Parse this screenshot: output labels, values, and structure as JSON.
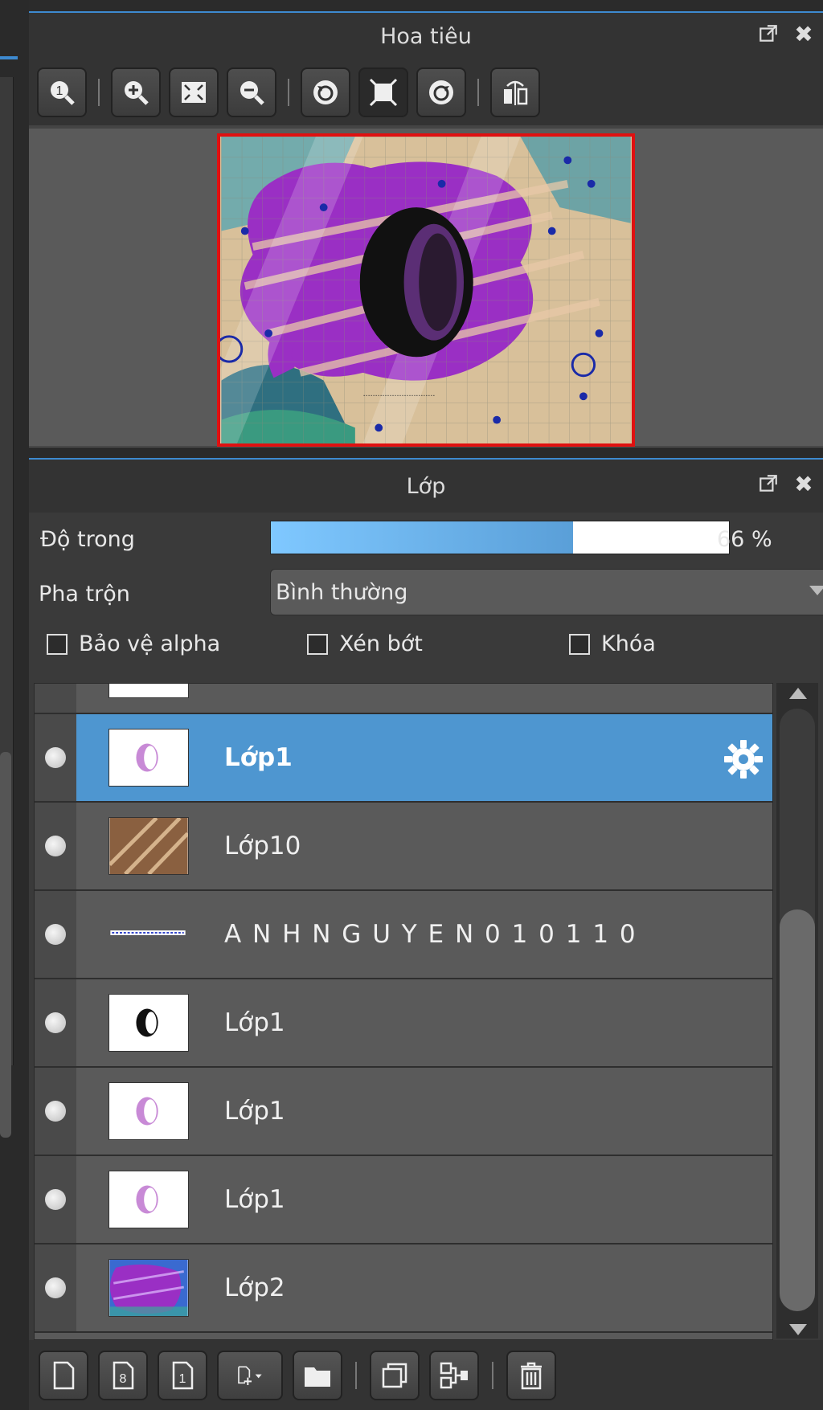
{
  "navigator": {
    "title": "Hoa tiêu",
    "tools": [
      "zoom-100-icon",
      "zoom-in-icon",
      "fit-window-icon",
      "zoom-out-icon",
      "rotate-left-icon",
      "fit-canvas-icon",
      "rotate-right-icon",
      "flip-icon"
    ],
    "preview_glyph": "O"
  },
  "layers_panel": {
    "title": "Lớp",
    "opacity_label": "Độ trong",
    "opacity_value": "66 %",
    "opacity_fraction": 0.66,
    "blend_label": "Pha trộn",
    "blend_value": "Bình thường",
    "checkboxes": {
      "protect_alpha": "Bảo vệ alpha",
      "clipping": "Xén bớt",
      "lock": "Khóa"
    },
    "layers": [
      {
        "name": "Lớp1",
        "selected": true,
        "thumb": "moon-pink"
      },
      {
        "name": "Lớp10",
        "selected": false,
        "thumb": "wood"
      },
      {
        "name": "A N H N G U Y E N 0 1 0 1 1 0",
        "selected": false,
        "thumb": "text-strip"
      },
      {
        "name": "Lớp1",
        "selected": false,
        "thumb": "moon-black"
      },
      {
        "name": "Lớp1",
        "selected": false,
        "thumb": "moon-pink"
      },
      {
        "name": "Lớp1",
        "selected": false,
        "thumb": "moon-pink"
      },
      {
        "name": "Lớp2",
        "selected": false,
        "thumb": "purple-paint"
      }
    ]
  },
  "colors": {
    "accent": "#3d8ad0",
    "selected_row": "#4e96d0",
    "preview_border": "#e01010"
  }
}
